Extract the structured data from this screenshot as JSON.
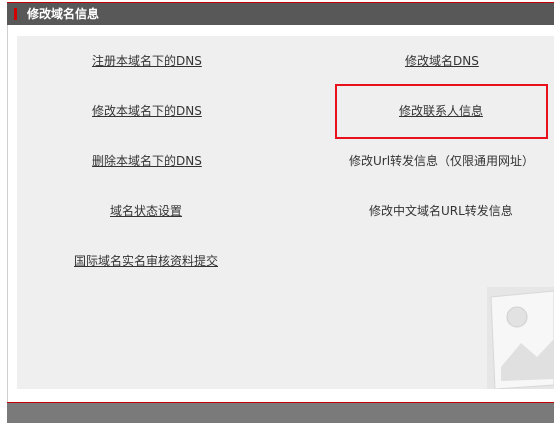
{
  "header": {
    "title": "修改域名信息"
  },
  "links": {
    "register_dns": "注册本域名下的DNS",
    "modify_domain_dns": "修改域名DNS",
    "modify_sub_dns": "修改本域名下的DNS",
    "modify_contact": "修改联系人信息",
    "delete_sub_dns": "删除本域名下的DNS",
    "modify_url_forward": "修改Url转发信息（仅限通用网址）",
    "domain_status": "域名状态设置",
    "modify_cn_url_forward": "修改中文域名URL转发信息",
    "realname_submit": "国际域名实名审核资料提交"
  },
  "colors": {
    "header_bg": "#585858",
    "accent_red": "#d40000",
    "highlight_border": "#e8101a",
    "panel_bg": "#efefef"
  }
}
